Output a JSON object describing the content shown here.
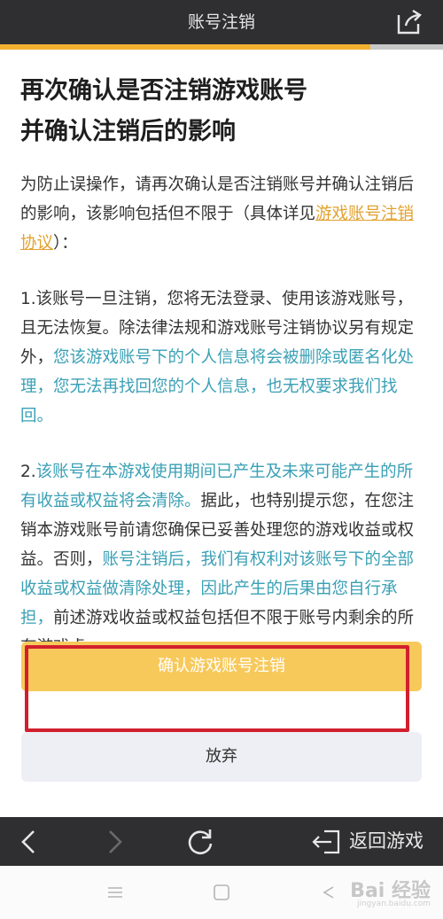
{
  "header": {
    "title": "账号注销"
  },
  "content": {
    "heading_line1": "再次确认是否注销游戏账号",
    "heading_line2": "并确认注销后的影响",
    "intro_text": "为防止误操作，请再次确认是否注销账号并确认注销后的影响，该影响包括但不限于（具体详见",
    "intro_link": "游戏账号注销协议",
    "intro_end": "）：",
    "p1_start": "1.该账号一旦注销，您将无法登录、使用该游戏账号，且无法恢复。除法律法规和游戏账号注销协议另有规定外，",
    "p1_hl": "您该游戏账号下的个人信息将会被删除或匿名化处理，您无法再找回您的个人信息，也无权要求我们找回。",
    "p2_num": "2.",
    "p2_hl1": "该账号在本游戏使用期间已产生及未来可能产生的所有收益或权益将会清除。",
    "p2_mid": "据此，也特别提示您，在您注销本游戏账号前请您确保已妥善处理您的游戏收益或权益。否则，",
    "p2_hl2": "账号注销后，我们有权利对该账号下的全部收益或权益做清除处理，因此产生的后果由您自行承担，",
    "p2_end": "前述游戏收益或权益包括但不限于账号内剩余的所有游戏虚"
  },
  "actions": {
    "confirm_label": "确认游戏账号注销",
    "giveup_label": "放弃"
  },
  "nav": {
    "back_game_label": "返回游戏"
  },
  "watermark": {
    "brand": "Bai 经验",
    "sub": "jingyan.baidu.com"
  },
  "colors": {
    "accent": "#f2b12f",
    "highlight": "#3aa0b5",
    "confirm_bg": "#f7c95a",
    "annotation_red": "#d21f2e"
  }
}
